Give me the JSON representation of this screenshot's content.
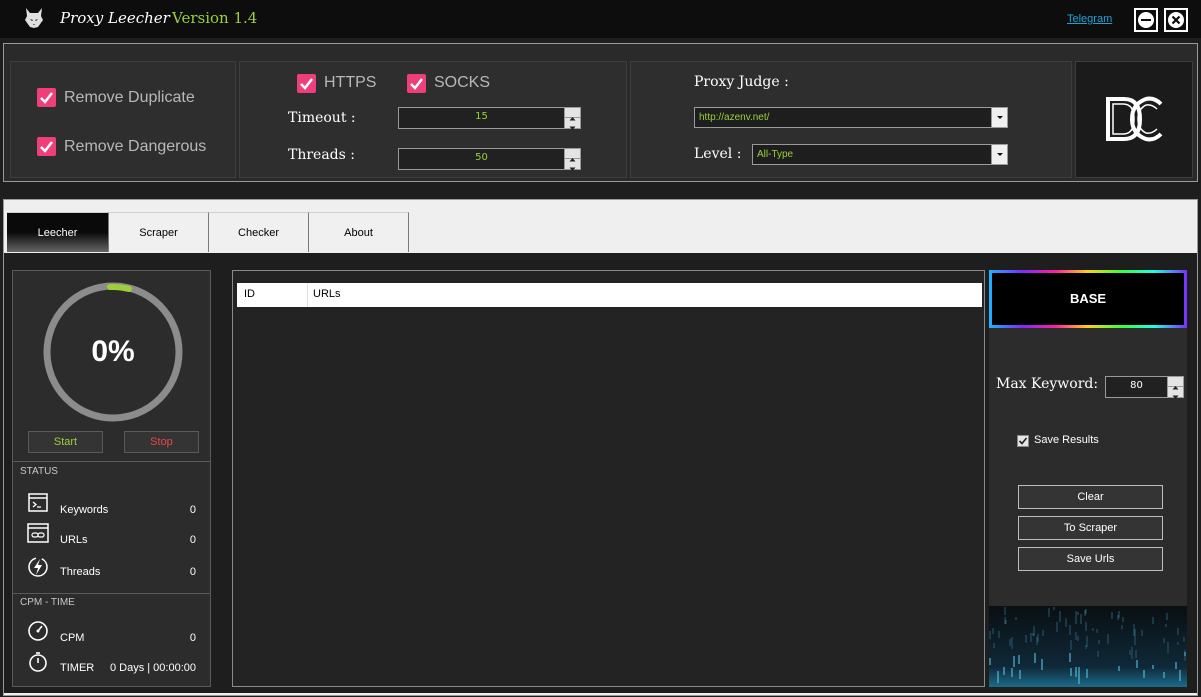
{
  "titlebar": {
    "title": "Proxy Leecher",
    "version": "Version 1.4",
    "telegram_link": "Telegram",
    "logo_icon": "wolf-icon",
    "minimize_icon": "minimize-icon",
    "close_icon": "close-icon"
  },
  "settings": {
    "remove_duplicate": {
      "label": "Remove Duplicate",
      "checked": true
    },
    "remove_dangerous": {
      "label": "Remove Dangerous",
      "checked": true
    },
    "https": {
      "label": "HTTPS",
      "checked": true
    },
    "socks": {
      "label": "SOCKS",
      "checked": true
    },
    "timeout_label": "Timeout :",
    "timeout_value": "15",
    "threads_label": "Threads :",
    "threads_value": "50",
    "proxy_judge_label": "Proxy Judge :",
    "proxy_judge_value": "http://azenv.net/",
    "level_label": "Level :",
    "level_value": "All-Type"
  },
  "tabs": [
    "Leecher",
    "Scraper",
    "Checker",
    "About"
  ],
  "active_tab": "Leecher",
  "progress": {
    "percent_text": "0%",
    "percent": 0
  },
  "controls": {
    "start": "Start",
    "stop": "Stop"
  },
  "status": {
    "header": "STATUS",
    "items": [
      {
        "label": "Keywords",
        "value": "0",
        "icon": "terminal-icon"
      },
      {
        "label": "URLs",
        "value": "0",
        "icon": "link-window-icon"
      },
      {
        "label": "Threads",
        "value": "0",
        "icon": "lightning-icon"
      }
    ]
  },
  "cpm_time": {
    "header": "CPM - TIME",
    "items": [
      {
        "label": "CPM",
        "value": "0",
        "icon": "speedometer-icon"
      },
      {
        "label": "TIMER",
        "value": "0 Days | 00:00:00",
        "icon": "stopwatch-icon"
      }
    ]
  },
  "table": {
    "columns": [
      "ID",
      "URLs"
    ],
    "rows": []
  },
  "right": {
    "base_label": "BASE",
    "max_keyword_label": "Max Keyword:",
    "max_keyword_value": "80",
    "save_results": {
      "label": "Save Results",
      "checked": true
    },
    "buttons": [
      "Clear",
      "To Scraper",
      "Save Urls"
    ]
  },
  "colors": {
    "accent_pink": "#ee3f7c",
    "accent_green": "#9ccf3a",
    "link_blue": "#1aa3d9"
  }
}
